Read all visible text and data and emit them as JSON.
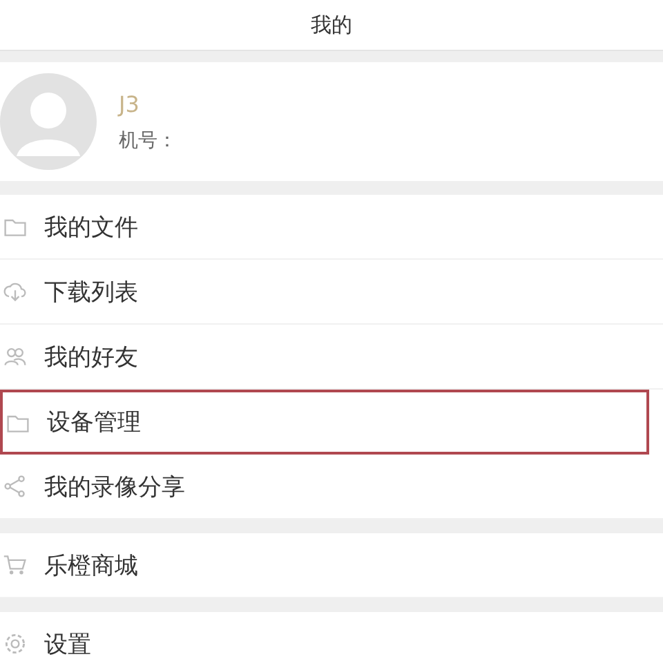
{
  "header": {
    "title": "我的"
  },
  "profile": {
    "name": "J3",
    "phone_label": "机号："
  },
  "menu_groups": [
    {
      "items": [
        {
          "label": "我的文件",
          "selected": false
        },
        {
          "label": "下载列表",
          "selected": false
        },
        {
          "label": "我的好友",
          "selected": false
        },
        {
          "label": "设备管理",
          "selected": true
        },
        {
          "label": "我的录像分享",
          "selected": false
        }
      ]
    },
    {
      "items": [
        {
          "label": "乐橙商城",
          "selected": false
        }
      ]
    },
    {
      "items": [
        {
          "label": "设置",
          "selected": false
        }
      ]
    }
  ]
}
